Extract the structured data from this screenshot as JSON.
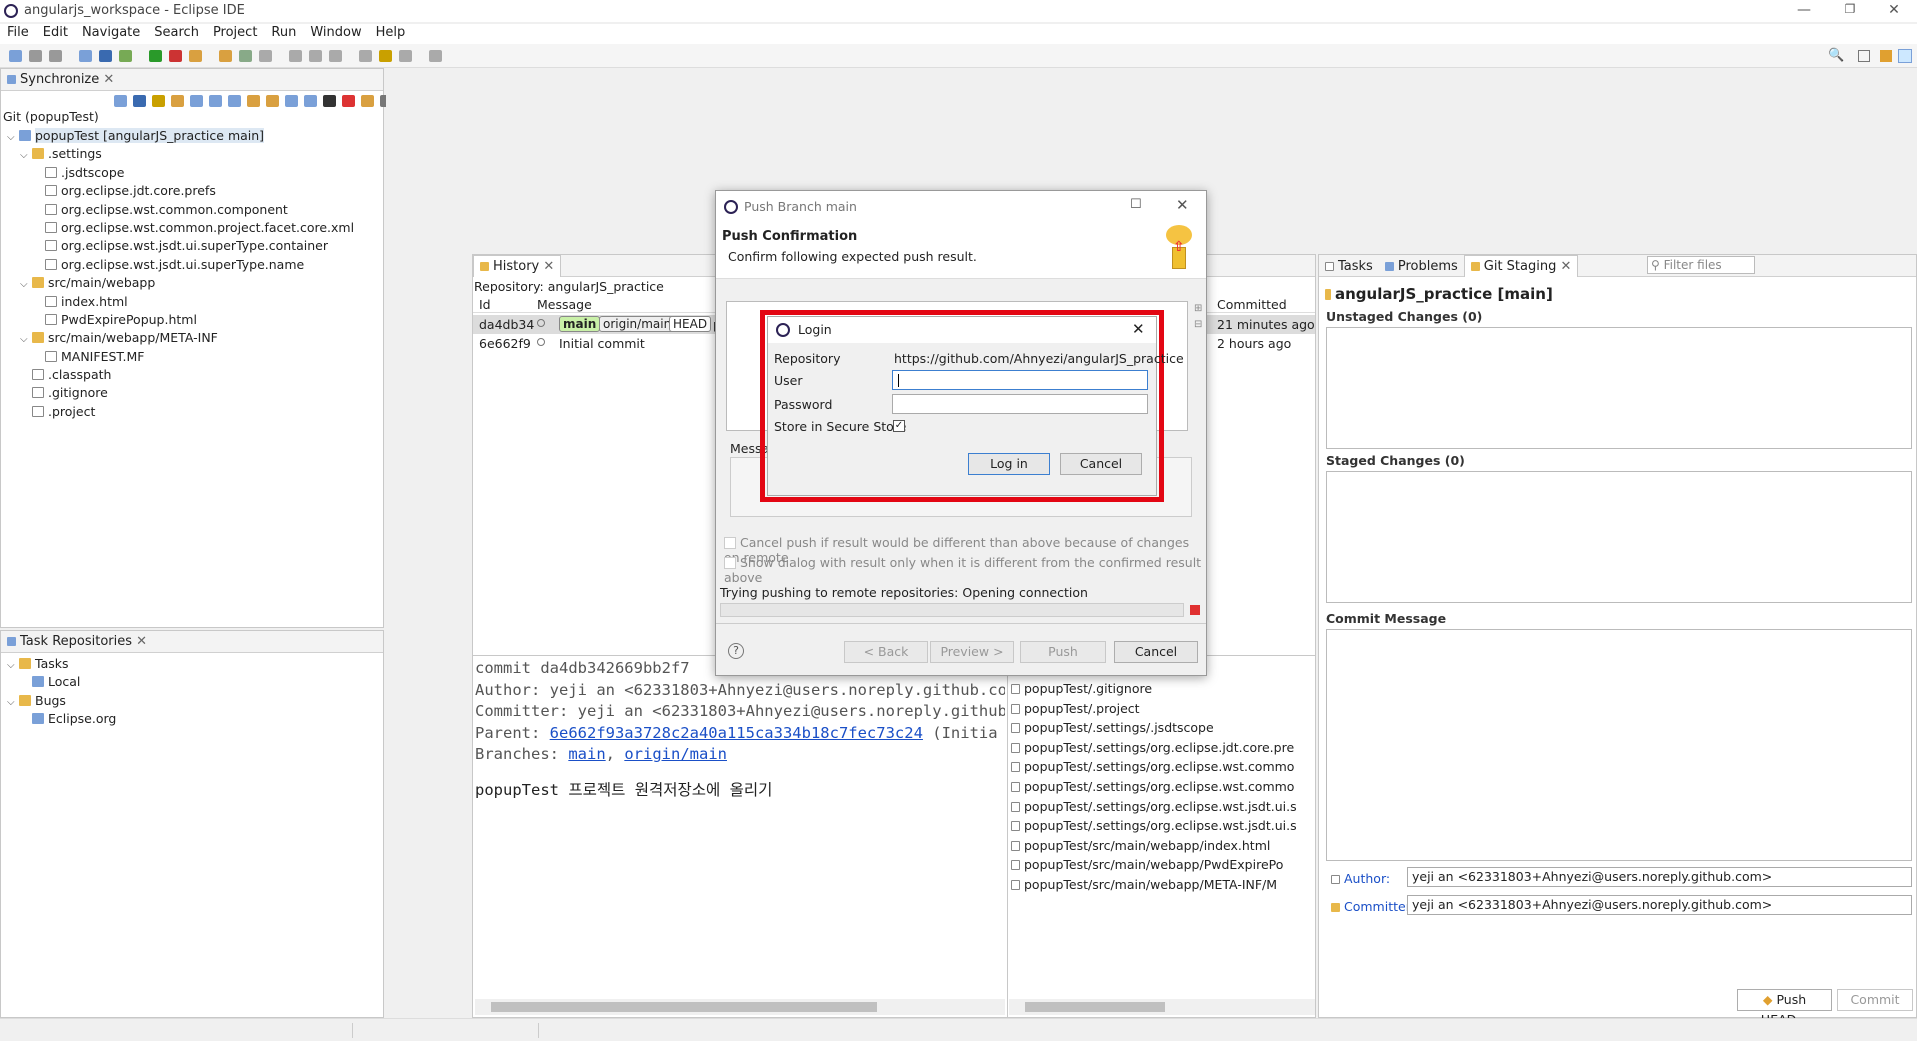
{
  "window": {
    "title": "angularjs_workspace - Eclipse IDE"
  },
  "menu": [
    "File",
    "Edit",
    "Navigate",
    "Search",
    "Project",
    "Run",
    "Window",
    "Help"
  ],
  "synchronize": {
    "tab": "Synchronize",
    "heading": "Git (popupTest)",
    "items": [
      {
        "label": "popupTest [angularJS_practice main]",
        "level": 0,
        "kind": "proj",
        "twisty": "v"
      },
      {
        "label": ".settings",
        "level": 1,
        "kind": "folder",
        "twisty": "v"
      },
      {
        "label": ".jsdtscope",
        "level": 2,
        "kind": "file",
        "twisty": ""
      },
      {
        "label": "org.eclipse.jdt.core.prefs",
        "level": 2,
        "kind": "file",
        "twisty": ""
      },
      {
        "label": "org.eclipse.wst.common.component",
        "level": 2,
        "kind": "file",
        "twisty": ""
      },
      {
        "label": "org.eclipse.wst.common.project.facet.core.xml",
        "level": 2,
        "kind": "file",
        "twisty": ""
      },
      {
        "label": "org.eclipse.wst.jsdt.ui.superType.container",
        "level": 2,
        "kind": "file",
        "twisty": ""
      },
      {
        "label": "org.eclipse.wst.jsdt.ui.superType.name",
        "level": 2,
        "kind": "file",
        "twisty": ""
      },
      {
        "label": "src/main/webapp",
        "level": 1,
        "kind": "folder",
        "twisty": "v"
      },
      {
        "label": "index.html",
        "level": 2,
        "kind": "file",
        "twisty": ""
      },
      {
        "label": "PwdExpirePopup.html",
        "level": 2,
        "kind": "file",
        "twisty": ""
      },
      {
        "label": "src/main/webapp/META-INF",
        "level": 1,
        "kind": "folder",
        "twisty": "v"
      },
      {
        "label": "MANIFEST.MF",
        "level": 2,
        "kind": "file",
        "twisty": ""
      },
      {
        "label": ".classpath",
        "level": 1,
        "kind": "file",
        "twisty": ""
      },
      {
        "label": ".gitignore",
        "level": 1,
        "kind": "file",
        "twisty": ""
      },
      {
        "label": ".project",
        "level": 1,
        "kind": "file",
        "twisty": ""
      }
    ]
  },
  "task_repos": {
    "tab": "Task Repositories",
    "items": [
      {
        "label": "Tasks",
        "level": 0,
        "kind": "folder",
        "twisty": "v"
      },
      {
        "label": "Local",
        "level": 1,
        "kind": "proj",
        "twisty": ""
      },
      {
        "label": "Bugs",
        "level": 0,
        "kind": "folder",
        "twisty": "v"
      },
      {
        "label": "Eclipse.org",
        "level": 1,
        "kind": "proj",
        "twisty": ""
      }
    ]
  },
  "history": {
    "tab": "History",
    "repo": "Repository: angularJS_practice",
    "col_id": "Id",
    "col_message": "Message",
    "col_date": "Committed Da...",
    "rows": [
      {
        "id": "da4db34",
        "message": "",
        "refs": [
          "main",
          "origin/main",
          "HEAD"
        ],
        "tail": "p",
        "date": "21 minutes ago"
      },
      {
        "id": "6e662f9",
        "message": "Initial commit",
        "refs": [],
        "tail": "",
        "date": "2 hours ago"
      }
    ],
    "commit_line": "commit da4db342669bb2f7",
    "author_line": "Author: yeji an <62331803+Ahnyezi@users.noreply.github.co",
    "committer_line": "Committer: yeji an <62331803+Ahnyezi@users.noreply.github",
    "parent_prefix": "Parent: ",
    "parent_hash": "6e662f93a3728c2a40a115ca334b18c7fec73c24",
    "parent_suffix": " (Initia",
    "branches_prefix": "Branches: ",
    "branch1": "main",
    "branch_sep": ", ",
    "branch2": "origin/main",
    "commit_msg": "popupTest 프로젝트 원격저장소에 올리기",
    "files": [
      "popupTest/.gitignore",
      "popupTest/.project",
      "popupTest/.settings/.jsdtscope",
      "popupTest/.settings/org.eclipse.jdt.core.pre",
      "popupTest/.settings/org.eclipse.wst.commo",
      "popupTest/.settings/org.eclipse.wst.commo",
      "popupTest/.settings/org.eclipse.wst.jsdt.ui.s",
      "popupTest/.settings/org.eclipse.wst.jsdt.ui.s",
      "popupTest/src/main/webapp/index.html",
      "popupTest/src/main/webapp/PwdExpirePo",
      "popupTest/src/main/webapp/META-INF/M"
    ]
  },
  "staging": {
    "tabs": [
      "Tasks",
      "Problems",
      "Git Staging"
    ],
    "filter_placeholder": "Filter files",
    "repo_title": "angularJS_practice [main]",
    "unstaged": "Unstaged Changes (0)",
    "staged": "Staged Changes (0)",
    "commit_message": "Commit Message",
    "author_label": "Author:",
    "author_value": "yeji an <62331803+Ahnyezi@users.noreply.github.com>",
    "committer_label": "Committer:",
    "committer_value": "yeji an <62331803+Ahnyezi@users.noreply.github.com>",
    "push_head": "Push HEAD...",
    "commit": "Commit"
  },
  "push_dialog": {
    "title": "Push Branch main",
    "heading": "Push Confirmation",
    "subheading": "Confirm following expected push result.",
    "message_label": "Messa",
    "cancel_if_diff": "Cancel push if result would be different than above because of changes on remote",
    "show_dialog": "Show dialog with result only when it is different from the confirmed result above",
    "progress_text": "Trying pushing to remote repositories: Opening connection",
    "back": "< Back",
    "preview": "Preview >",
    "push": "Push",
    "cancel": "Cancel"
  },
  "login": {
    "title": "Login",
    "repo_label": "Repository",
    "repo_value": "https://github.com/Ahnyezi/angularJS_practice",
    "user_label": "User",
    "user_value": "",
    "password_label": "Password",
    "store_label": "Store in Secure Store",
    "login_btn": "Log in",
    "cancel_btn": "Cancel"
  },
  "colors": {
    "highlight": "#e30613",
    "selection": "#cde8ff",
    "link": "#1a4fc7",
    "ref_green": "#c9f0a8"
  }
}
